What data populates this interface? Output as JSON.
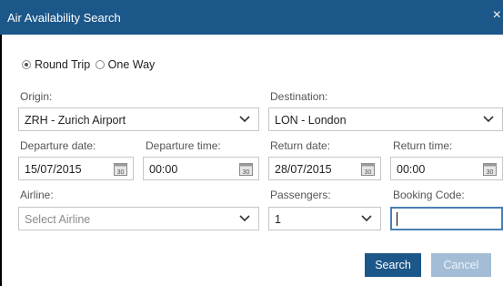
{
  "window": {
    "title": "Air Availability Search",
    "close_glyph": "×"
  },
  "trip_type": {
    "options": [
      {
        "label": "Round Trip",
        "selected": true
      },
      {
        "label": "One Way",
        "selected": false
      }
    ]
  },
  "origin": {
    "label": "Origin:",
    "value": "ZRH - Zurich Airport"
  },
  "destination": {
    "label": "Destination:",
    "value": "LON - London"
  },
  "departure_date": {
    "label": "Departure date:",
    "value": "15/07/2015",
    "icon": "calendar-icon"
  },
  "departure_time": {
    "label": "Departure time:",
    "value": "00:00",
    "icon": "calendar-icon"
  },
  "return_date": {
    "label": "Return date:",
    "value": "28/07/2015",
    "icon": "calendar-icon"
  },
  "return_time": {
    "label": "Return time:",
    "value": "00:00",
    "icon": "calendar-icon"
  },
  "airline": {
    "label": "Airline:",
    "placeholder": "Select Airline",
    "value": ""
  },
  "passengers": {
    "label": "Passengers:",
    "value": "1"
  },
  "booking_code": {
    "label": "Booking Code:",
    "value": ""
  },
  "calendar_icon_text": "30",
  "buttons": {
    "search": "Search",
    "cancel": "Cancel"
  },
  "colors": {
    "accent": "#1c5789",
    "cancel_disabled": "#a3bdd6",
    "focus_border": "#4a7fb5"
  }
}
